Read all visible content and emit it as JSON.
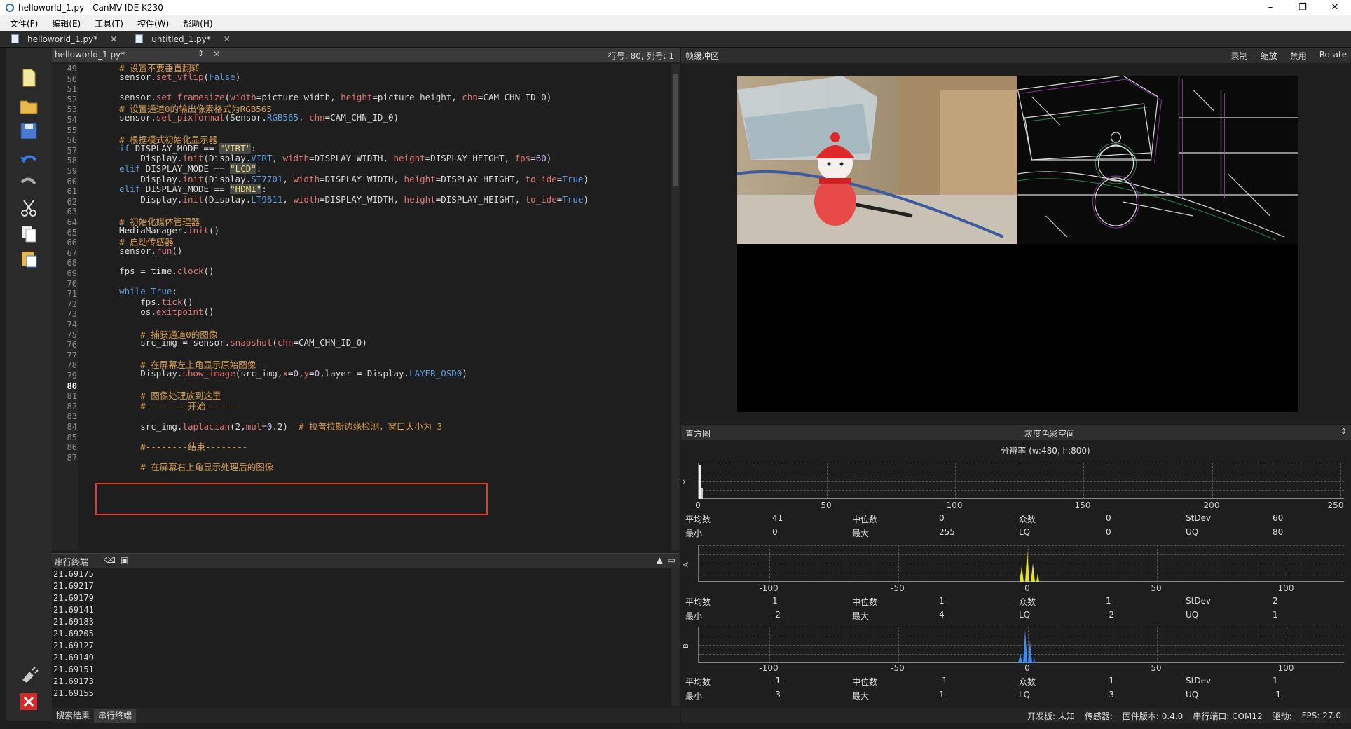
{
  "window": {
    "title": "helloworld_1.py - CanMV IDE K230",
    "controls": [
      "–",
      "❐",
      "✕"
    ]
  },
  "menu": [
    "文件(F)",
    "编辑(E)",
    "工具(T)",
    "控件(W)",
    "帮助(H)"
  ],
  "file_tabs": [
    {
      "label": "helloworld_1.py*",
      "close": "✕"
    },
    {
      "label": "untitled_1.py*",
      "close": "✕"
    }
  ],
  "editor": {
    "file_name": "helloworld_1.py*",
    "position": "行号: 80, 列号: 1",
    "line_numbers": [
      "49",
      "50",
      "51",
      "52",
      "53",
      "54",
      "55",
      "56",
      "57",
      "58",
      "59",
      "60",
      "61",
      "62",
      "63",
      "64",
      "65",
      "66",
      "67",
      "68",
      "69",
      "70",
      "71",
      "72",
      "73",
      "74",
      "75",
      "76",
      "77",
      "78",
      "79",
      "80",
      "81",
      "82",
      "83",
      "84",
      "85",
      "86",
      "87"
    ],
    "lines": [
      "    # 设置不要垂直翻转",
      "    sensor.set_vflip(False)",
      "",
      "    sensor.set_framesize(width=picture_width, height=picture_height, chn=CAM_CHN_ID_0)",
      "    # 设置通道0的输出像素格式为RGB565",
      "    sensor.set_pixformat(Sensor.RGB565, chn=CAM_CHN_ID_0)",
      "",
      "    # 根据模式初始化显示器",
      "    if DISPLAY_MODE == \"VIRT\":",
      "        Display.init(Display.VIRT, width=DISPLAY_WIDTH, height=DISPLAY_HEIGHT, fps=60)",
      "    elif DISPLAY_MODE == \"LCD\":",
      "        Display.init(Display.ST7701, width=DISPLAY_WIDTH, height=DISPLAY_HEIGHT, to_ide=True)",
      "    elif DISPLAY_MODE == \"HDMI\":",
      "        Display.init(Display.LT9611, width=DISPLAY_WIDTH, height=DISPLAY_HEIGHT, to_ide=True)",
      "",
      "    # 初始化媒体管理器",
      "    MediaManager.init()",
      "    # 启动传感器",
      "    sensor.run()",
      "",
      "    fps = time.clock()",
      "",
      "    while True:",
      "        fps.tick()",
      "        os.exitpoint()",
      "",
      "        # 捕获通道0的图像",
      "        src_img = sensor.snapshot(chn=CAM_CHN_ID_0)",
      "",
      "        # 在屏幕左上角显示原始图像",
      "        Display.show_image(src_img,x=0,y=0,layer = Display.LAYER_OSD0)",
      "",
      "        # 图像处理放到这里",
      "        #--------开始--------",
      "",
      "        src_img.laplacian(2,mul=0.2)  # 拉普拉斯边缘检测，窗口大小为 3",
      "",
      "        #--------结束--------",
      "",
      "        # 在屏幕右上角显示处理后的图像"
    ]
  },
  "serial": {
    "title": "串行终端",
    "lines": [
      "21.69175",
      "21.69217",
      "21.69179",
      "21.69141",
      "21.69183",
      "21.69205",
      "21.69127",
      "21.69149",
      "21.69151",
      "21.69173",
      "21.69155"
    ]
  },
  "bottom_tabs": [
    "搜索结果",
    "串行终端"
  ],
  "framebuffer": {
    "title": "帧缓冲区",
    "actions": [
      "录制",
      "缩放",
      "禁用",
      "Rotate"
    ]
  },
  "histogram": {
    "title": "直方图",
    "colorspace": "灰度色彩空间",
    "resolution": "分辨率 (w:480, h:800)",
    "channels": [
      {
        "label": "Y",
        "ticks": [
          "0",
          "50",
          "100",
          "150",
          "200",
          "250"
        ],
        "stats": {
          "mean_label": "平均数",
          "mean": "41",
          "median_label": "中位数",
          "median": "0",
          "mode_label": "众数",
          "mode": "0",
          "stdev_label": "StDev",
          "stdev": "60",
          "min_label": "最小",
          "min": "0",
          "max_label": "最大",
          "max": "255",
          "lq_label": "LQ",
          "lq": "0",
          "uq_label": "UQ",
          "uq": "80"
        }
      },
      {
        "label": "A",
        "ticks": [
          "-100",
          "-50",
          "0",
          "50",
          "100"
        ],
        "stats": {
          "mean_label": "平均数",
          "mean": "1",
          "median_label": "中位数",
          "median": "1",
          "mode_label": "众数",
          "mode": "1",
          "stdev_label": "StDev",
          "stdev": "2",
          "min_label": "最小",
          "min": "-2",
          "max_label": "最大",
          "max": "4",
          "lq_label": "LQ",
          "lq": "-2",
          "uq_label": "UQ",
          "uq": "1"
        }
      },
      {
        "label": "B",
        "ticks": [
          "-100",
          "-50",
          "0",
          "50",
          "100"
        ],
        "stats": {
          "mean_label": "平均数",
          "mean": "-1",
          "median_label": "中位数",
          "median": "-1",
          "mode_label": "众数",
          "mode": "-1",
          "stdev_label": "StDev",
          "stdev": "1",
          "min_label": "最小",
          "min": "-3",
          "max_label": "最大",
          "max": "1",
          "lq_label": "LQ",
          "lq": "-3",
          "uq_label": "UQ",
          "uq": "-1"
        }
      }
    ]
  },
  "status": [
    "开发板: 未知",
    "传感器:",
    "固件版本: 0.4.0",
    "串行端口: COM12",
    "驱动:",
    "FPS:   27.0"
  ],
  "colors": {
    "accent_red": "#e23c2c",
    "hist_a": "#e6e61e",
    "hist_b": "#3c8cf0",
    "bg": "#1e1e1e"
  }
}
